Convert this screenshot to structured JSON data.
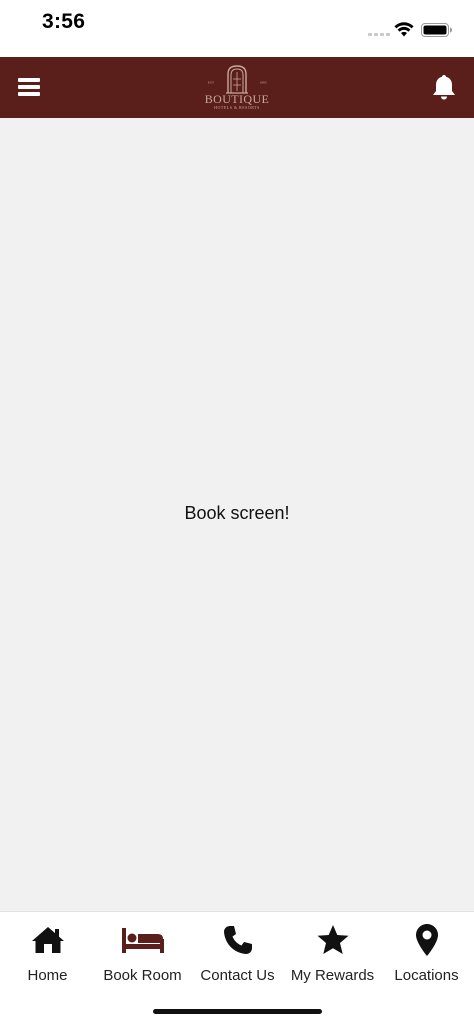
{
  "status_bar": {
    "time": "3:56"
  },
  "header": {
    "logo_text": "BOUTIQUE",
    "logo_subtext": "HOTELS & RESORTS",
    "logo_left_mark": "EST",
    "logo_right_mark": "1983"
  },
  "main": {
    "text": "Book screen!"
  },
  "tabs": [
    {
      "label": "Home",
      "icon": "home-icon",
      "active": false
    },
    {
      "label": "Book Room",
      "icon": "bed-icon",
      "active": true
    },
    {
      "label": "Contact Us",
      "icon": "phone-icon",
      "active": false
    },
    {
      "label": "My Rewards",
      "icon": "star-icon",
      "active": false
    },
    {
      "label": "Locations",
      "icon": "map-pin-icon",
      "active": false
    }
  ],
  "colors": {
    "header_bg": "#5a1f1a",
    "active_tab": "#5a1f1a",
    "content_bg": "#f1f1f1"
  }
}
